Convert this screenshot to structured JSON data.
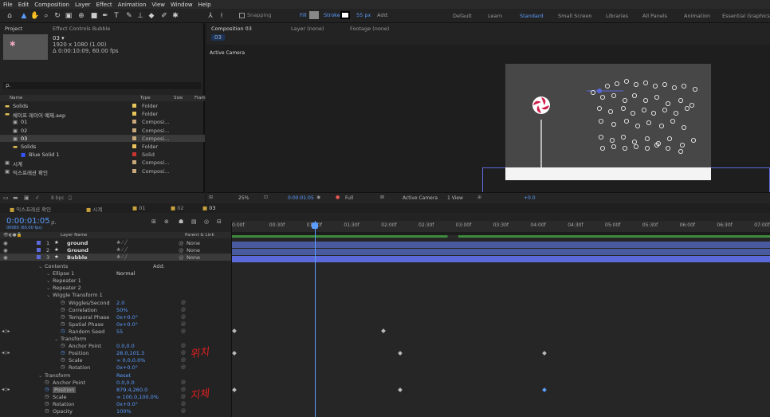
{
  "menu": [
    "File",
    "Edit",
    "Composition",
    "Layer",
    "Effect",
    "Animation",
    "View",
    "Window",
    "Help"
  ],
  "toolbar": {
    "snapping": "Snapping",
    "fill": "Fill",
    "stroke": "Stroke",
    "stroke_px": "55 px",
    "add": "Add:"
  },
  "workspaces": [
    "Default",
    "Learn",
    "Standard",
    "Small Screen",
    "Libraries",
    "All Panels",
    "Animation",
    "Essential Graphics"
  ],
  "project": {
    "tab": "Project",
    "effect_tab": "Effect Controls Bubble",
    "item_name": "03 ▾",
    "item_size": "1920 x 1080 (1.00)",
    "item_dur": "Δ 0:00:10:09, 60.00 fps",
    "search_placeholder": "ρ.",
    "cols": [
      "Name",
      "Type",
      "Size",
      "Fram"
    ],
    "items": [
      {
        "name": "Solids",
        "type": "Folder",
        "indent": 0
      },
      {
        "name": "쉐이프 레이어 예제.aep",
        "type": "Folder",
        "indent": 0
      },
      {
        "name": "01",
        "type": "Composi...",
        "indent": 1
      },
      {
        "name": "02",
        "type": "Composi...",
        "indent": 1
      },
      {
        "name": "03",
        "type": "Composi...",
        "indent": 1
      },
      {
        "name": "Solids",
        "type": "Folder",
        "indent": 1
      },
      {
        "name": "Blue Solid 1",
        "type": "Solid",
        "indent": 2
      },
      {
        "name": "시계",
        "type": "Composi...",
        "indent": 0
      },
      {
        "name": "익스프레션 확인",
        "type": "Composi...",
        "indent": 0
      }
    ],
    "bpc": "8 bpc"
  },
  "comp": {
    "tab": "Composition 03",
    "layer_tab": "Layer (none)",
    "footage_tab": "Footage (none)",
    "sub_tab": "03",
    "active_camera": "Active Camera"
  },
  "viewbar": {
    "zoom": "25%",
    "time": "0:00:01:05",
    "quality": "Full",
    "camera": "Active Camera",
    "views": "1 View",
    "exposure": "+0.0"
  },
  "timeline": {
    "tabs": [
      "익스프레션 확인",
      "시계",
      "01",
      "02",
      "03"
    ],
    "time": "0:00:01:05",
    "fps": "00065 (60.00 fps)",
    "search_placeholder": "ρ.",
    "header": {
      "layer_name": "Layer Name",
      "parent": "Parent & Link"
    },
    "ruler": [
      "0:00f",
      "00:30f",
      "01:00f",
      "01:30f",
      "02:00f",
      "02:30f",
      "03:00f",
      "03:30f",
      "04:00f",
      "04:30f",
      "05:00f",
      "05:30f",
      "06:00f",
      "06:30f",
      "07:00f"
    ],
    "layers": [
      {
        "num": "1",
        "name": "ground",
        "parent": "None"
      },
      {
        "num": "2",
        "name": "Ground",
        "parent": "None"
      },
      {
        "num": "3",
        "name": "Bubble",
        "parent": "None"
      }
    ],
    "props": [
      {
        "label": "Contents",
        "indent": 0,
        "value": "",
        "extra": "Add:"
      },
      {
        "label": "Ellipse 1",
        "indent": 1,
        "value": "Normal"
      },
      {
        "label": "Repeater 1",
        "indent": 1,
        "value": ""
      },
      {
        "label": "Repeater 2",
        "indent": 1,
        "value": ""
      },
      {
        "label": "Wiggle Transform 1",
        "indent": 1,
        "value": ""
      },
      {
        "label": "Wiggles/Second",
        "indent": 3,
        "value": "2.0"
      },
      {
        "label": "Correlation",
        "indent": 3,
        "value": "50%"
      },
      {
        "label": "Temporal Phase",
        "indent": 3,
        "value": "0x+0.0°"
      },
      {
        "label": "Spatial Phase",
        "indent": 3,
        "value": "0x+0.0°"
      },
      {
        "label": "Random Seed",
        "indent": 3,
        "value": "55"
      },
      {
        "label": "Transform",
        "indent": 2,
        "value": ""
      },
      {
        "label": "Anchor Point",
        "indent": 3,
        "value": "0.0,0.0"
      },
      {
        "label": "Position",
        "indent": 3,
        "value": "28.0,101.3"
      },
      {
        "label": "Scale",
        "indent": 3,
        "value": "∞ 0.0,0.0%"
      },
      {
        "label": "Rotation",
        "indent": 3,
        "value": "0x+0.0°"
      },
      {
        "label": "Transform",
        "indent": 0,
        "value": "Reset"
      },
      {
        "label": "Anchor Point",
        "indent": 1,
        "value": "0.0,0.0"
      },
      {
        "label": "Position",
        "indent": 1,
        "value": "879.4,260.0"
      },
      {
        "label": "Scale",
        "indent": 1,
        "value": "∞ 100.0,100.0%"
      },
      {
        "label": "Rotation",
        "indent": 1,
        "value": "0x+0.0°"
      },
      {
        "label": "Opacity",
        "indent": 1,
        "value": "100%"
      }
    ],
    "annotations": [
      "위치",
      "지체"
    ]
  },
  "colors": {
    "accent": "#5b9cff",
    "label_blue": "#5b6ad8",
    "bar": "#4a5a9e",
    "annotation": "#e02020"
  }
}
